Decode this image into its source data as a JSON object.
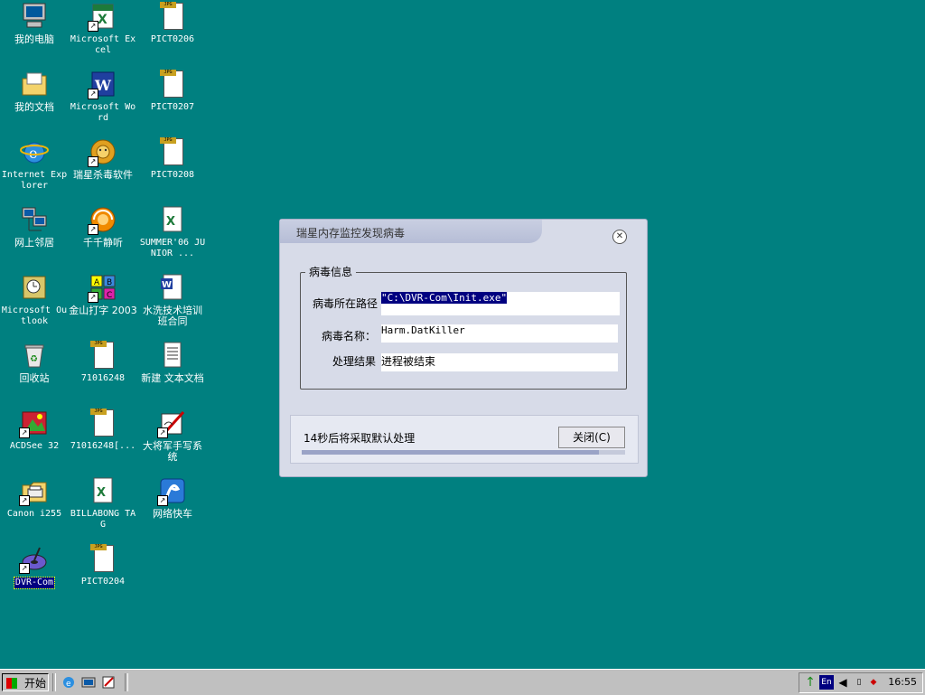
{
  "desktop": {
    "icons": [
      {
        "label": "我的电脑"
      },
      {
        "label": "Microsoft Excel"
      },
      {
        "label": "PICT0206"
      },
      {
        "label": "我的文档"
      },
      {
        "label": "Microsoft Word"
      },
      {
        "label": "PICT0207"
      },
      {
        "label": "Internet Explorer"
      },
      {
        "label": "瑞星杀毒软件"
      },
      {
        "label": "PICT0208"
      },
      {
        "label": "网上邻居"
      },
      {
        "label": "千千静听"
      },
      {
        "label": "SUMMER'06 JUNIOR ..."
      },
      {
        "label": "Microsoft Outlook"
      },
      {
        "label": "金山打字 2003"
      },
      {
        "label": "水洗技术培训班合同"
      },
      {
        "label": "回收站"
      },
      {
        "label": "71016248"
      },
      {
        "label": "新建 文本文档"
      },
      {
        "label": "ACDSee 32"
      },
      {
        "label": "71016248[..."
      },
      {
        "label": "大将军手写系统"
      },
      {
        "label": "Canon i255"
      },
      {
        "label": "BILLABONG TAG"
      },
      {
        "label": "网络快车"
      },
      {
        "label": "DVR-Com"
      },
      {
        "label": "PICT0204"
      }
    ]
  },
  "dialog": {
    "title": "瑞星内存监控发现病毒",
    "close_glyph": "✕",
    "group_title": "病毒信息",
    "path_label": "病毒所在路径",
    "path_value": "\"C:\\DVR-Com\\Init.exe\"",
    "name_label": "病毒名称：",
    "name_value": "Harm.DatKiller",
    "result_label": "处理结果",
    "result_value": "进程被结束",
    "countdown_text": "14秒后将采取默认处理",
    "close_button": "关闭(C)",
    "progress_fraction": 0.92
  },
  "taskbar": {
    "start_label": "开始",
    "input_method": "En",
    "clock": "16:55"
  },
  "colors": {
    "desktop": "#008080",
    "selection": "#000080",
    "dialog_bg": "#d7dbe8"
  }
}
